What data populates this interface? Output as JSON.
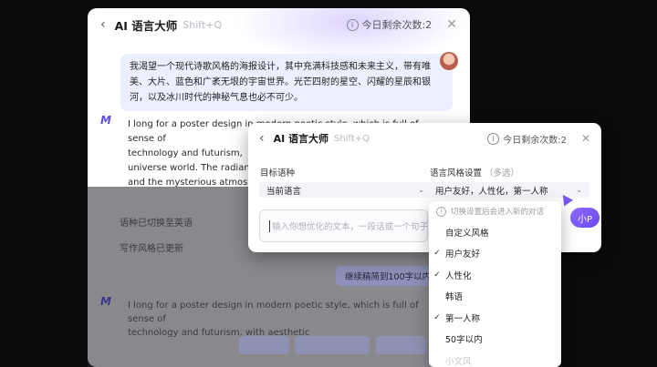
{
  "back_window": {
    "title": "AI 语言大师",
    "shortcut": "Shift+Q",
    "quota": "今日剩余次数:2",
    "user_message": "我渴望一个现代诗歌风格的海报设计，其中充满科技感和未来主义，带有唯美、大片、蓝色和广袤无垠的宇宙世界。光芒四射的星空、闪耀的星辰和银河，以及冰川时代的神秘气息也必不可少。",
    "ai_reply_lines": [
      "I long for a poster design in modern poetic style, which is full of sense of",
      "technology and futurism,",
      "universe world. The radiant sta",
      "and the mysterious atmospher"
    ],
    "status_language": "语种已切换至英语",
    "status_style": "写作风格已更新",
    "continue_action": "继续精简到100字以内",
    "ai_reply2_lines": [
      "I long for a poster design in modern poetic style, which is full of sense of",
      "technology and futurism, with aesthetic"
    ]
  },
  "front_window": {
    "title": "AI 语言大师",
    "shortcut": "Shift+Q",
    "quota": "今日剩余次数:2",
    "target_label": "目标语种",
    "target_value": "当前语言",
    "style_label": "语言风格设置",
    "style_optional": "（多选）",
    "style_value": "用户友好，人性化，第一人称",
    "input_placeholder": "输入你想优化的文本，一段话或一个句子"
  },
  "assistant_badge": "小P",
  "dropdown": {
    "tip": "切换设置后会进入新的对话",
    "items": [
      {
        "label": "自定义风格",
        "checked": false
      },
      {
        "label": "用户友好",
        "checked": true
      },
      {
        "label": "人性化",
        "checked": true
      },
      {
        "label": "韩语",
        "checked": false
      },
      {
        "label": "第一人称",
        "checked": true
      },
      {
        "label": "50字以内",
        "checked": false
      },
      {
        "label": "小文风",
        "checked": false
      }
    ]
  },
  "icons": [
    "back-arrow-icon",
    "info-icon",
    "close-icon",
    "ai-logo-icon",
    "check-icon",
    "chevron-down-icon",
    "pointer-cursor-icon"
  ]
}
